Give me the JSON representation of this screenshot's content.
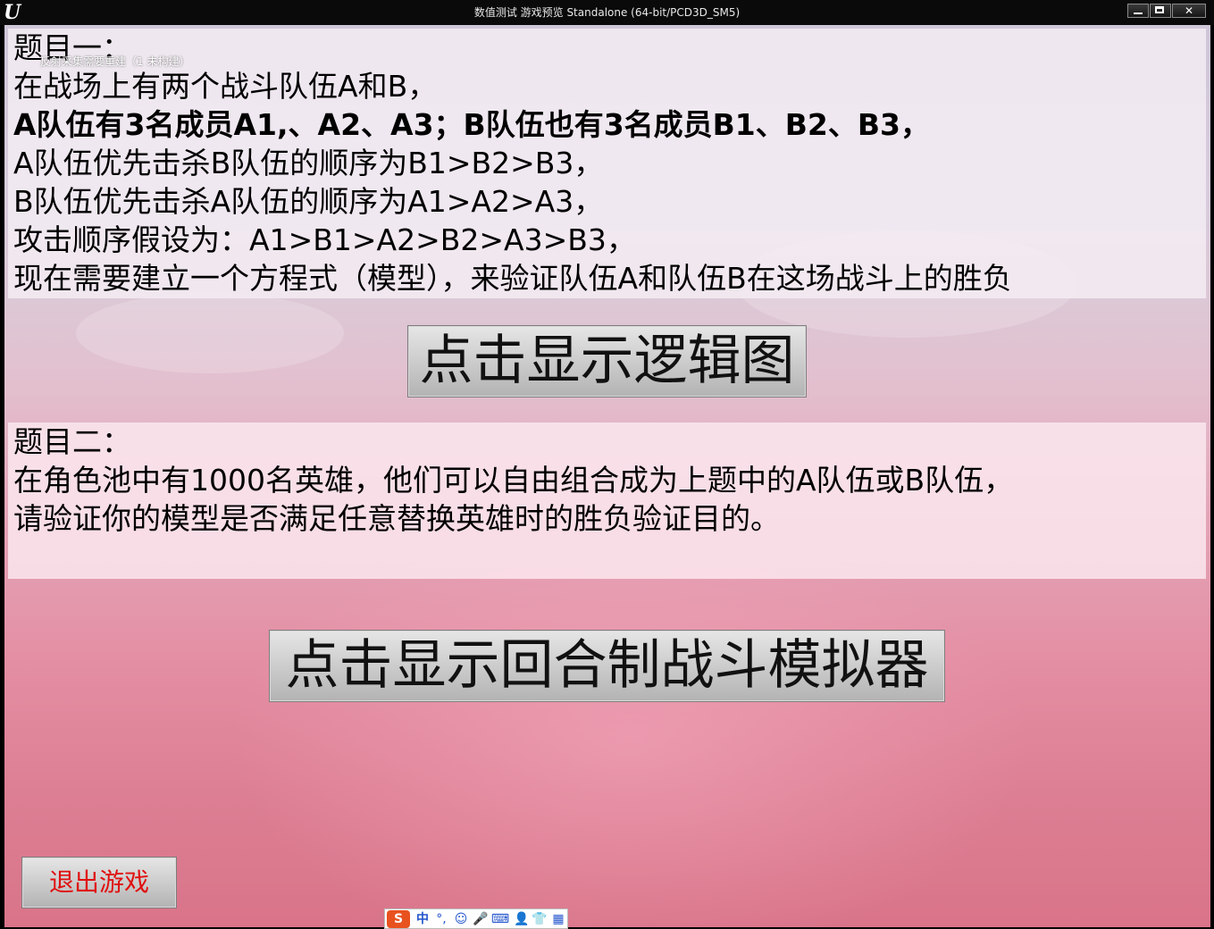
{
  "window": {
    "title": "数值测试 游戏预览 Standalone (64-bit/PCD3D_SM5)",
    "logo": "U",
    "controls": [
      "minimize",
      "maximize",
      "close"
    ],
    "close_glyph": "✕"
  },
  "debug": {
    "message": "反射采集需要重建（1 未构建）"
  },
  "question1": {
    "heading": "题目一：",
    "lines": [
      "在战场上有两个战斗队伍A和B，",
      "A队伍有3名成员A1,、A2、A3；B队伍也有3名成员B1、B2、B3，",
      "A队伍优先击杀B队伍的顺序为B1>B2>B3，",
      "B队伍优先击杀A队伍的顺序为A1>A2>A3，",
      "攻击顺序假设为：A1>B1>A2>B2>A3>B3，",
      "现在需要建立一个方程式（模型），来验证队伍A和队伍B在这场战斗上的胜负"
    ]
  },
  "buttons": {
    "show_logic": "点击显示逻辑图",
    "show_simulator": "点击显示回合制战斗模拟器",
    "exit": "退出游戏"
  },
  "question2": {
    "heading": "题目二：",
    "lines": [
      "在角色池中有1000名英雄，他们可以自由组合成为上题中的A队伍或B队伍，",
      "请验证你的模型是否满足任意替换英雄时的胜负验证目的。"
    ]
  },
  "ime": {
    "logo": "S",
    "mode": "中",
    "punct": "°,",
    "icons": [
      "emoji-icon",
      "microphone-icon",
      "keyboard-icon",
      "user-icon",
      "skin-icon",
      "grid-icon"
    ],
    "brand_color": "#e8521f"
  }
}
